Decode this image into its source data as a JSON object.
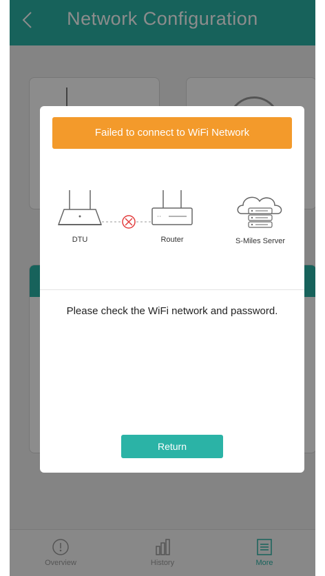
{
  "header": {
    "title": "Network Configuration",
    "back_icon": "chevron-left-icon"
  },
  "modal": {
    "banner": "Failed to connect to WiFi Network",
    "devices": [
      {
        "label": "DTU",
        "icon": "dtu-device-icon"
      },
      {
        "label": "Router",
        "icon": "router-icon"
      },
      {
        "label": "S-Miles Server",
        "icon": "cloud-server-icon"
      }
    ],
    "connection_status_icon": "error-x-circle-icon",
    "message": "Please check the WiFi network and password.",
    "return_label": "Return"
  },
  "bottom_nav": {
    "items": [
      {
        "label": "Overview",
        "icon": "overview-icon",
        "active": false
      },
      {
        "label": "History",
        "icon": "bar-chart-icon",
        "active": false
      },
      {
        "label": "More",
        "icon": "list-icon",
        "active": true
      }
    ]
  },
  "colors": {
    "accent": "#2bb3a6",
    "error_banner": "#f39a2b",
    "error_icon": "#e23c3c",
    "overlay": "rgba(0,0,0,0.45)"
  }
}
